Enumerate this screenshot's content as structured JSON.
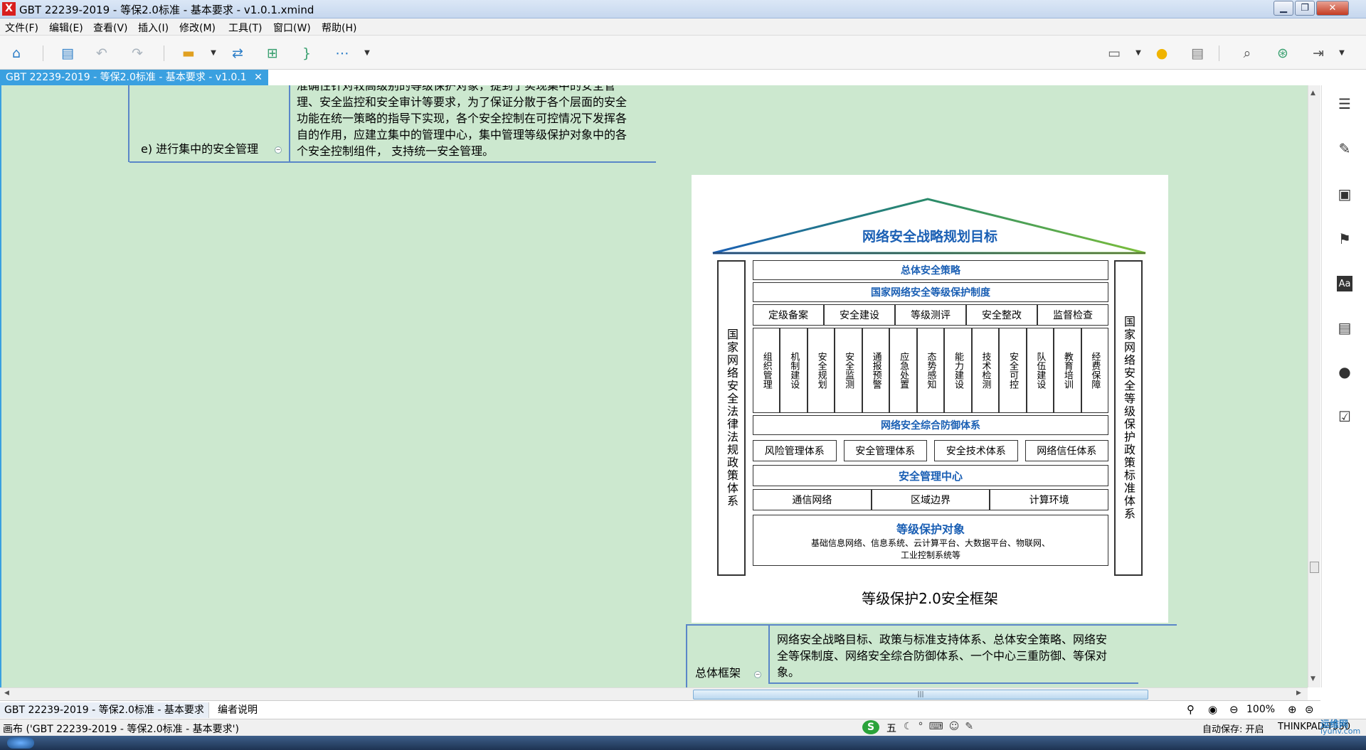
{
  "window": {
    "title": "GBT 22239-2019 - 等保2.0标准 - 基本要求 - v1.0.1.xmind",
    "app_icon": "X",
    "min": "▁",
    "max": "❐",
    "close": "✕"
  },
  "menu": [
    "文件(F)",
    "编辑(E)",
    "查看(V)",
    "插入(I)",
    "修改(M)",
    "工具(T)",
    "窗口(W)",
    "帮助(H)"
  ],
  "tab": {
    "label": "GBT 22239-2019 - 等保2.0标准 - 基本要求 - v1.0.1",
    "close": "✕"
  },
  "canvas": {
    "upper_branch_label": "e) 进行集中的安全管理",
    "upper_collapse": "−",
    "upper_text": [
      "准确性针对较高级别的等级保护对象，提到了实现集中的安全管",
      "理、安全监控和安全审计等要求，为了保证分散于各个层面的安全",
      "功能在统一策略的指导下实现，各个安全控制在可控情况下发挥各",
      "自的作用，应建立集中的管理中心，集中管理等级保护对象中的各",
      "个安全控制组件， 支持统一安全管理。"
    ],
    "lower_branch_label": "总体框架",
    "lower_collapse": "−",
    "lower_text": [
      "网络安全战略目标、政策与标准支持体系、总体安全策略、网络安",
      "全等保制度、网络安全综合防御体系、一个中心三重防御、等保对",
      "象。"
    ]
  },
  "diagram": {
    "roof_title": "网络安全战略规划目标",
    "left_pillar": "国家网络安全法律法规政策体系",
    "right_pillar": "国家网络安全等级保护政策标准体系",
    "row1": "总体安全策略",
    "row2": "国家网络安全等级保护制度",
    "row3": [
      "定级备案",
      "安全建设",
      "等级测评",
      "安全整改",
      "监督检查"
    ],
    "row4": [
      "组织管理",
      "机制建设",
      "安全规划",
      "安全监测",
      "通报预警",
      "应急处置",
      "态势感知",
      "能力建设",
      "技术检测",
      "安全可控",
      "队伍建设",
      "教育培训",
      "经费保障"
    ],
    "row5": "网络安全综合防御体系",
    "row6": [
      "风险管理体系",
      "安全管理体系",
      "安全技术体系",
      "网络信任体系"
    ],
    "row7": "安全管理中心",
    "row8": [
      "通信网络",
      "区域边界",
      "计算环境"
    ],
    "row9_title": "等级保护对象",
    "row9_sub1": "基础信息网络、信息系统、云计算平台、大数据平台、物联网、",
    "row9_sub2": "工业控制系统等",
    "caption": "等级保护2.0安全框架"
  },
  "sheets": [
    "GBT 22239-2019 - 等保2.0标准 - 基本要求",
    "编者说明"
  ],
  "status": {
    "left": "画布 ('GBT 22239-2019 - 等保2.0标准 - 基本要求')",
    "zoom": "100%",
    "autosave": "自动保存: 开启",
    "machine": "THINKPAD-T530",
    "ime": "五",
    "watermark": "运维网",
    "watermark_url": "iyunv.com"
  },
  "colors": {
    "canvas": "#cce8cf",
    "accent": "#3aa0e0",
    "diagram_blue": "#1a5fb4"
  }
}
